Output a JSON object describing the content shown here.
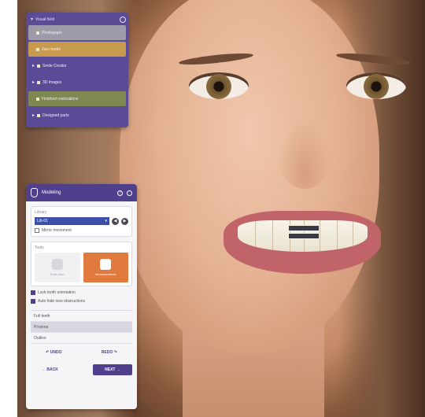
{
  "layers_panel": {
    "title": "Visual field",
    "rows": [
      {
        "label": "Photograph",
        "style": "grey"
      },
      {
        "label": "Jaw model",
        "style": "orange"
      },
      {
        "label": "Smile Creator",
        "style": "plain"
      },
      {
        "label": "3D Images",
        "style": "plain"
      },
      {
        "label": "Finished restorations",
        "style": "green"
      },
      {
        "label": "Designed parts",
        "style": "plain"
      }
    ]
  },
  "modeling_panel": {
    "title": "Modeling",
    "library": {
      "label": "Library",
      "selected": "Lib-01",
      "mirror_label": "Mirror movement"
    },
    "tools": {
      "label": "Tools",
      "items": [
        {
          "label": "Free-form",
          "active": false
        },
        {
          "label": "Measurements",
          "active": true
        }
      ]
    },
    "options": [
      {
        "label": "Lock tooth orientation",
        "checked": true
      },
      {
        "label": "Auto hide new obstructions",
        "checked": true
      }
    ],
    "list": [
      {
        "label": "Full teeth",
        "selected": false
      },
      {
        "label": "Proxima",
        "selected": true
      },
      {
        "label": "Outline",
        "selected": false
      }
    ],
    "undo_label": "↶ UNDO",
    "redo_label": "REDO ↷",
    "back_label": "← BACK",
    "next_label": "NEXT →"
  },
  "colors": {
    "panel_purple": "#5b4a96",
    "header_purple": "#4f3f8c",
    "accent_orange": "#e07a3e",
    "select_blue": "#3e4fa8"
  }
}
